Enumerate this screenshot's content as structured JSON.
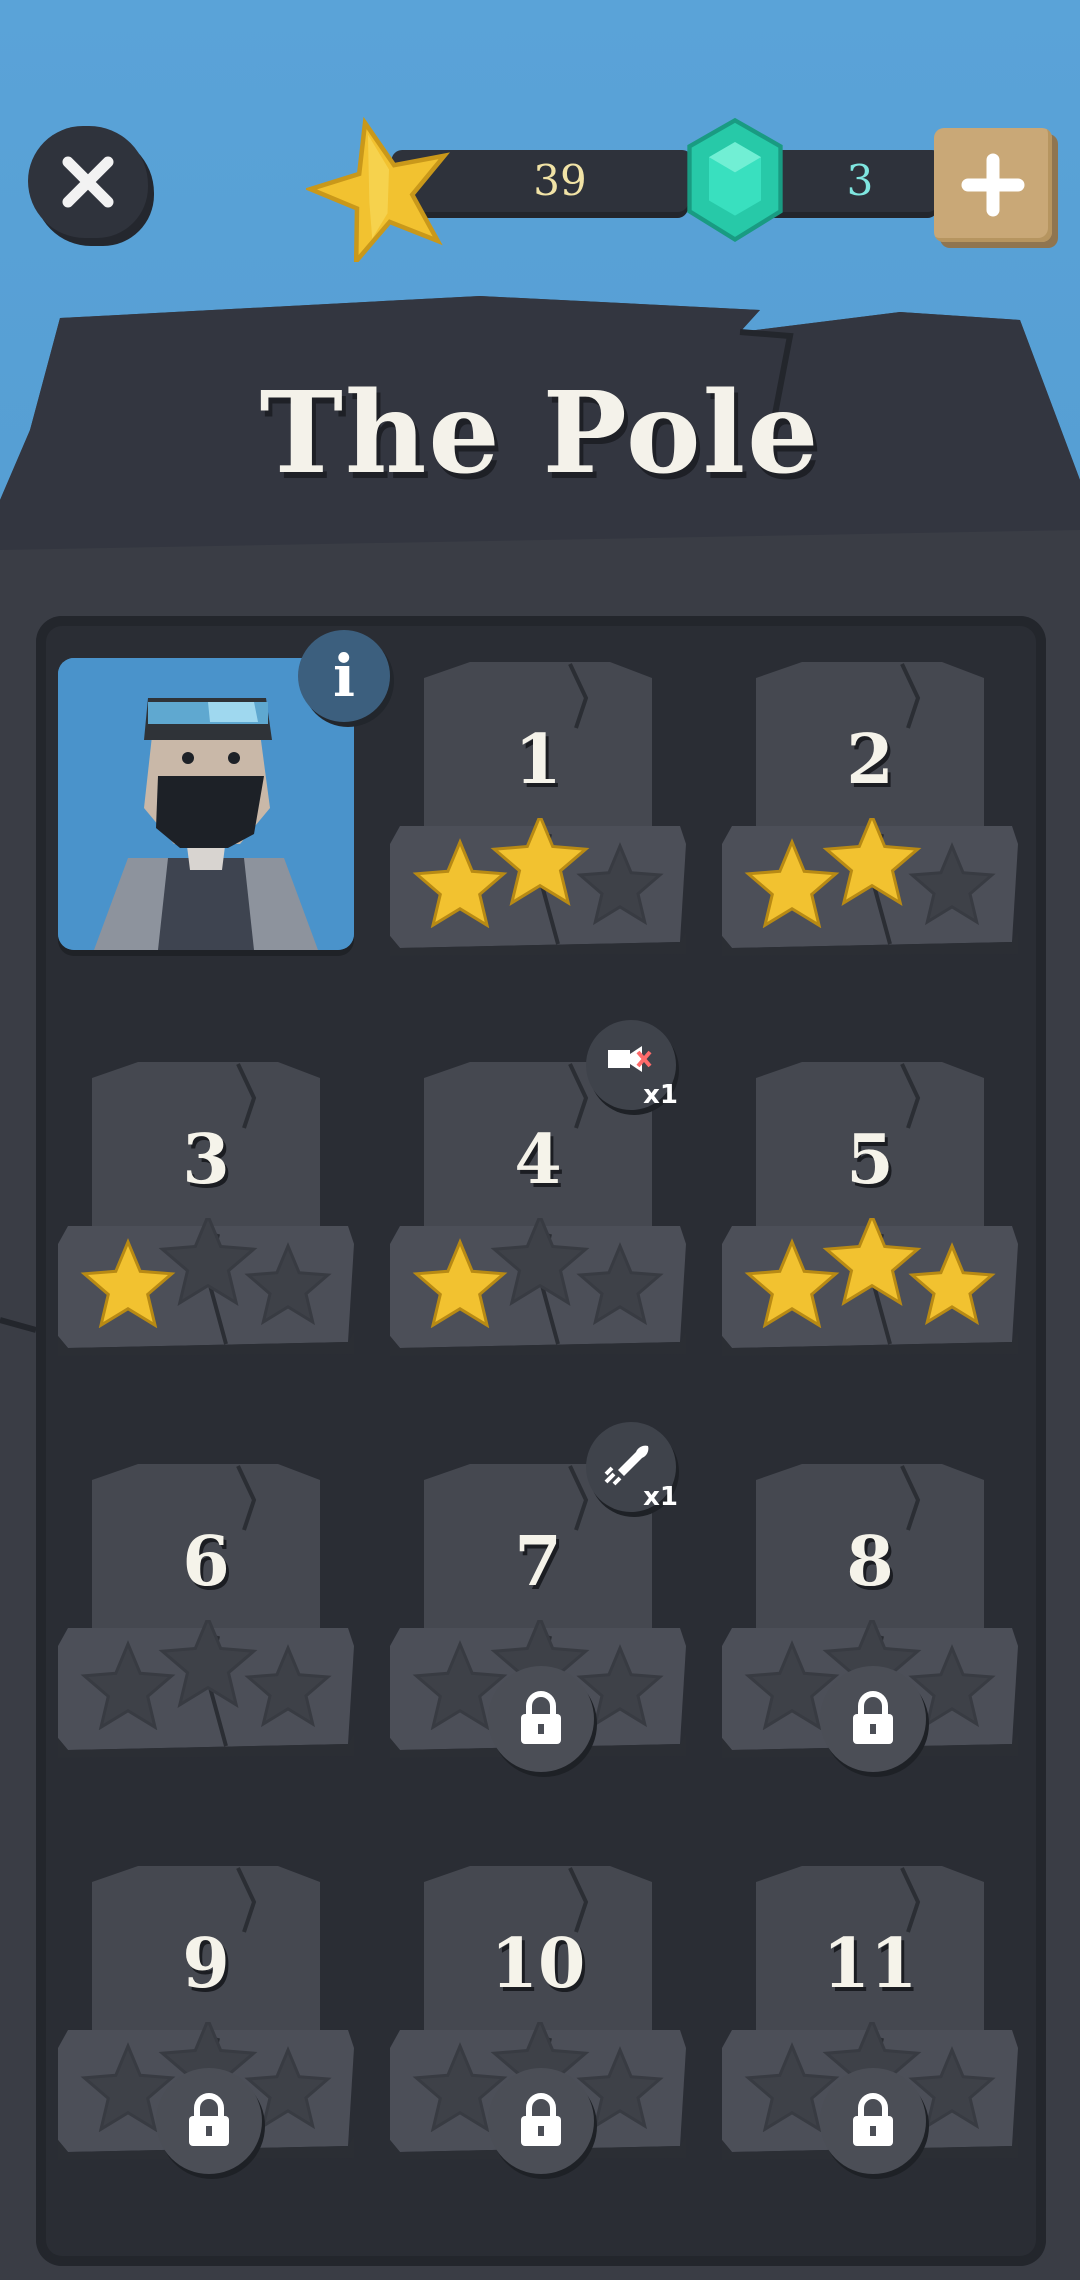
{
  "resources": {
    "stars": "39",
    "gems": "3"
  },
  "icons": {
    "close": "close-icon",
    "star": "star-icon",
    "gem": "gem-icon",
    "plus": "plus-icon",
    "info": "info-icon",
    "lock": "lock-icon"
  },
  "colors": {
    "star_gold": "#f2c230",
    "gem_teal": "#2fd6b5",
    "slab": "#474a52",
    "panel": "#2a2d34"
  },
  "world": {
    "title": "The Pole",
    "info_label": "i"
  },
  "levels": [
    {
      "label": "1",
      "stars": 2,
      "locked": false
    },
    {
      "label": "2",
      "stars": 2,
      "locked": false
    },
    {
      "label": "3",
      "stars": 1,
      "locked": false
    },
    {
      "label": "4",
      "stars": 1,
      "locked": false,
      "powerup": {
        "icon": "muted-cannon-icon",
        "count": "x1"
      }
    },
    {
      "label": "5",
      "stars": 3,
      "locked": false
    },
    {
      "label": "6",
      "stars": 0,
      "locked": false
    },
    {
      "label": "7",
      "stars": 0,
      "locked": true,
      "powerup": {
        "icon": "rocket-icon",
        "count": "x1"
      }
    },
    {
      "label": "8",
      "stars": 0,
      "locked": true
    },
    {
      "label": "9",
      "stars": 0,
      "locked": true
    },
    {
      "label": "10",
      "stars": 0,
      "locked": true
    },
    {
      "label": "11",
      "stars": 0,
      "locked": true
    }
  ]
}
